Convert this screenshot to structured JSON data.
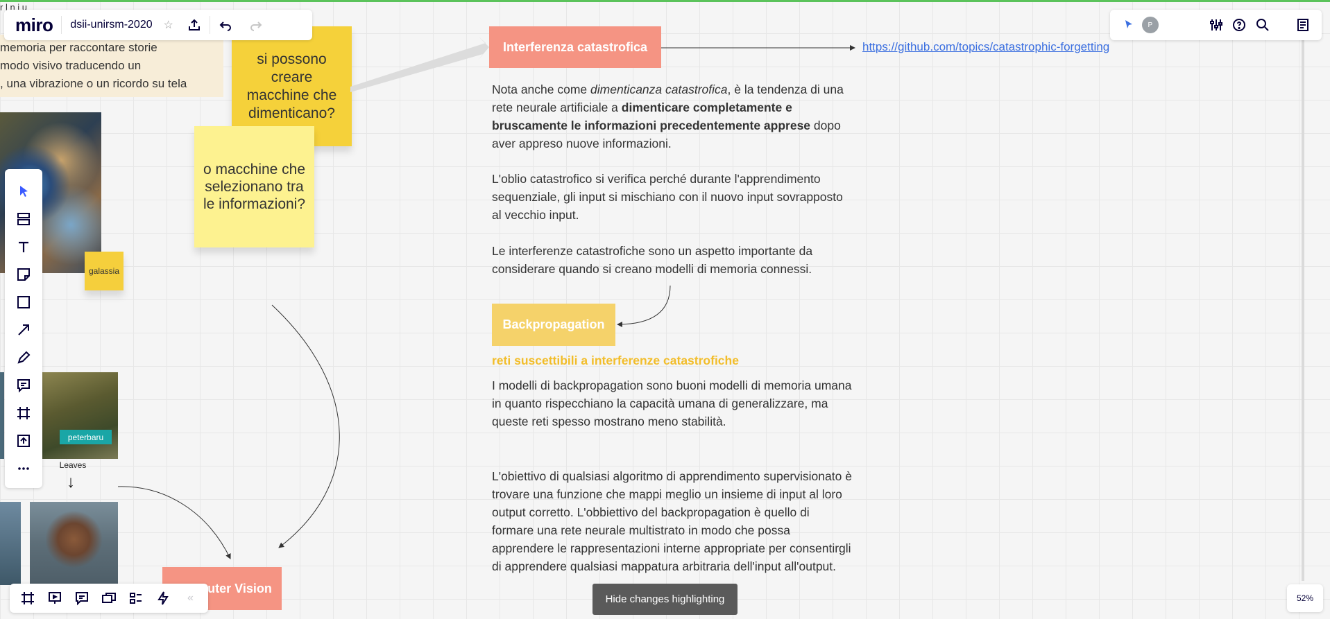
{
  "app": {
    "logo": "miro",
    "board_name": "dsii-unirsm-2020",
    "top_clipped_text": "r l n i u",
    "zoom": "52%"
  },
  "canvas": {
    "story_lines": [
      "memoria per raccontare storie",
      "modo visivo traducendo un",
      ", una vibrazione o un ricordo su tela"
    ],
    "sticky_galassia": "galassia",
    "sticky_q1": "si possono creare macchine che dimenticano?",
    "sticky_q2": "o macchine che selezionano tra le informazioni?",
    "tag_peterbaru": "peterbaru",
    "leaves_label": "Leaves",
    "title_interferenza": "Interferenza catastrofica",
    "link": "https://github.com/topics/catastrophic-forgetting",
    "p1_a": "Nota anche come ",
    "p1_em": "dimenticanza catastrofica",
    "p1_b": ", è la tendenza di una rete neurale artificiale a ",
    "p1_strong": "dimenticare completamente e bruscamente le informazioni precedentemente apprese",
    "p1_c": " dopo aver appreso nuove informazioni.",
    "p2": "L'oblio catastrofico si verifica perché durante l'apprendimento sequenziale, gli input si mischiano con il nuovo input sovrapposto al vecchio input.",
    "p3": "Le interferenze catastrofiche sono un aspetto importante da considerare quando si creano modelli di memoria connessi.",
    "title_backprop": "Backpropagation",
    "subhead": "reti suscettibili a interferenze catastrofiche",
    "p4": "I modelli di backpropagation sono buoni modelli di memoria umana in quanto rispecchiano la capacità umana di generalizzare, ma queste reti spesso mostrano meno stabilità.",
    "p5": "L'obiettivo di qualsiasi algoritmo di apprendimento supervisionato è trovare una funzione che mappi meglio un insieme di input al loro output corretto. L'obbiettivo del backpropagation è quello di formare una rete neurale multistrato in modo che possa apprendere le rappresentazioni interne appropriate per consentirgli di apprendere qualsiasi mappatura arbitraria dell'input all'output.",
    "title_cv": "Computer Vision"
  },
  "footer": {
    "hide_changes": "Hide changes highlighting",
    "collapse": "«"
  },
  "colors": {
    "salmon": "#f59483",
    "yellow": "#f5d13a",
    "pale_yellow": "#fdf290",
    "accent_subhead": "#f2bd2a",
    "link": "#3b6fe0",
    "teal_tag": "#1aa6a6"
  }
}
